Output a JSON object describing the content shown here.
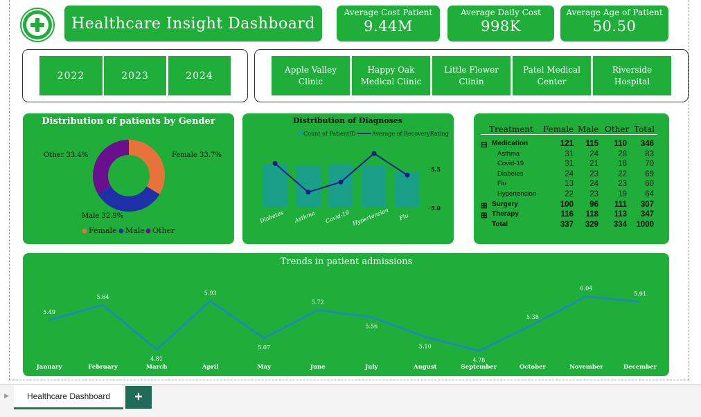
{
  "header": {
    "title": "Healthcare Insight Dashboard"
  },
  "kpis": [
    {
      "label": "Average Cost Patient",
      "value": "9.44M"
    },
    {
      "label": "Average Daily Cost",
      "value": "998K"
    },
    {
      "label": "Average Age of Patient",
      "value": "50.50"
    }
  ],
  "years": [
    "2022",
    "2023",
    "2024"
  ],
  "clinics": [
    {
      "line1": "Apple Valley",
      "line2": "Clinic"
    },
    {
      "line1": "Happy Oak",
      "line2": "Medical Clinic"
    },
    {
      "line1": "Little Flower",
      "line2": "Clinin"
    },
    {
      "line1": "Patel Medical",
      "line2": "Center"
    },
    {
      "line1": "Riverside",
      "line2": "Hospital"
    }
  ],
  "gender_chart": {
    "title": "Distribution of patients by Gender",
    "labels": {
      "female": "Female 33.7%",
      "male": "Male 32.9%",
      "other": "Other 33.4%"
    },
    "legend": [
      "Female",
      "Male",
      "Other"
    ],
    "colors": {
      "female": "#e8733a",
      "male": "#1f2fa8",
      "other": "#6a0f8e"
    }
  },
  "diagnoses_chart": {
    "title": "Distribution of Diagnoses",
    "legend": [
      "Count of PatientID",
      "Average of RecoveryRating"
    ],
    "axis_labels": [
      "5.5",
      "5.0"
    ]
  },
  "treatment_table": {
    "headers": [
      "Treatment",
      "Female",
      "Male",
      "Other",
      "Total"
    ],
    "rows": [
      {
        "name": "Medication",
        "expander": "⊟",
        "bold": true,
        "female": "121",
        "male": "115",
        "other": "110",
        "total": "346"
      },
      {
        "name": "Asthma",
        "expander": "",
        "bold": false,
        "female": "31",
        "male": "24",
        "other": "28",
        "total": "83"
      },
      {
        "name": "Covid-19",
        "expander": "",
        "bold": false,
        "female": "31",
        "male": "21",
        "other": "18",
        "total": "70"
      },
      {
        "name": "Diabetes",
        "expander": "",
        "bold": false,
        "female": "24",
        "male": "23",
        "other": "22",
        "total": "69"
      },
      {
        "name": "Flu",
        "expander": "",
        "bold": false,
        "female": "13",
        "male": "24",
        "other": "23",
        "total": "60"
      },
      {
        "name": "Hypertension",
        "expander": "",
        "bold": false,
        "female": "22",
        "male": "23",
        "other": "19",
        "total": "64"
      },
      {
        "name": "Surgery",
        "expander": "⊞",
        "bold": true,
        "female": "100",
        "male": "96",
        "other": "111",
        "total": "307"
      },
      {
        "name": "Therapy",
        "expander": "⊞",
        "bold": true,
        "female": "116",
        "male": "118",
        "other": "113",
        "total": "347"
      },
      {
        "name": "Total",
        "expander": "",
        "bold": true,
        "female": "337",
        "male": "329",
        "other": "334",
        "total": "1000"
      }
    ]
  },
  "trend_chart": {
    "title": "Trends in patient admissions"
  },
  "chart_data": [
    {
      "type": "pie",
      "title": "Distribution of patients by Gender",
      "categories": [
        "Female",
        "Male",
        "Other"
      ],
      "values": [
        33.7,
        32.9,
        33.4
      ]
    },
    {
      "type": "bar",
      "title": "Distribution of Diagnoses",
      "categories": [
        "Diabetes",
        "Asthma",
        "Covid-19",
        "Hypertension",
        "Flu"
      ],
      "series": [
        {
          "name": "Count of PatientID",
          "type": "bar",
          "values": [
            211,
            205,
            208,
            204,
            172
          ]
        },
        {
          "name": "Average of RecoveryRating",
          "type": "line",
          "values": [
            5.55,
            5.18,
            5.31,
            5.68,
            5.4
          ]
        }
      ]
    },
    {
      "type": "line",
      "title": "Trends in patient admissions",
      "categories": [
        "January",
        "February",
        "March",
        "April",
        "May",
        "June",
        "July",
        "August",
        "September",
        "October",
        "November",
        "December"
      ],
      "values": [
        5.49,
        5.84,
        4.81,
        5.93,
        5.07,
        5.72,
        5.56,
        5.1,
        4.78,
        5.38,
        6.04,
        5.91
      ],
      "ylim": [
        4.4,
        6.4
      ]
    }
  ],
  "tabs": {
    "sheet_name": "Healthcare Dashboard",
    "add_label": "+",
    "scroll_arrow": "▶"
  }
}
